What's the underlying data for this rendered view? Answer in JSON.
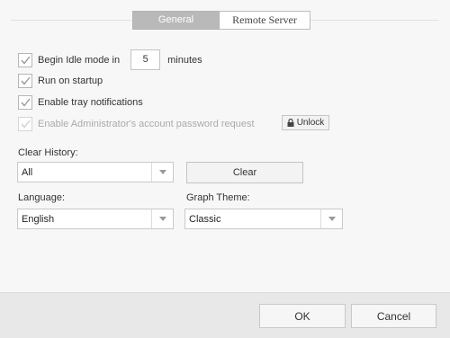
{
  "tabs": [
    {
      "label": "General",
      "active": true
    },
    {
      "label": "Remote Server",
      "active": false
    }
  ],
  "options": {
    "idle_mode": {
      "label": "Begin Idle mode in",
      "checked": true,
      "value": "5",
      "unit": "minutes"
    },
    "run_on_startup": {
      "label": "Run on startup",
      "checked": true
    },
    "tray_notifications": {
      "label": "Enable tray notifications",
      "checked": true
    },
    "admin_password": {
      "label": "Enable Administrator's account password request",
      "checked": true,
      "disabled": true
    },
    "unlock_label": "Unlock"
  },
  "clear_history": {
    "label": "Clear History:",
    "selected": "All",
    "button_label": "Clear"
  },
  "language": {
    "label": "Language:",
    "selected": "English"
  },
  "graph_theme": {
    "label": "Graph Theme:",
    "selected": "Classic"
  },
  "footer": {
    "ok_label": "OK",
    "cancel_label": "Cancel"
  },
  "icons": {
    "checkbox": "checkmark-icon",
    "unlock": "lock-icon",
    "dropdown": "chevron-down-icon"
  }
}
